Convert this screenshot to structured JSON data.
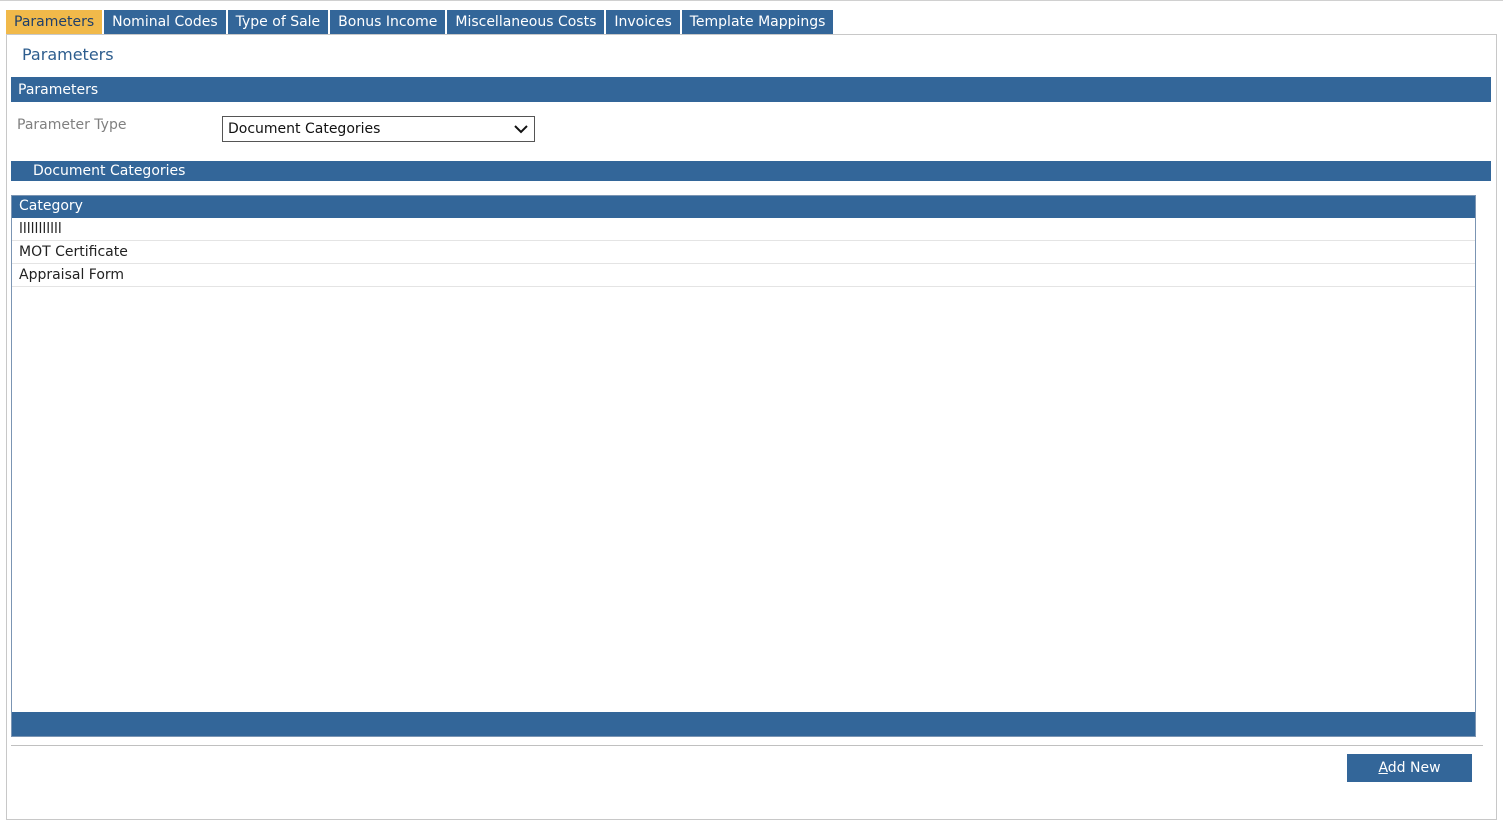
{
  "tabs": [
    {
      "label": "Parameters",
      "active": true
    },
    {
      "label": "Nominal Codes",
      "active": false
    },
    {
      "label": "Type of Sale",
      "active": false
    },
    {
      "label": "Bonus Income",
      "active": false
    },
    {
      "label": "Miscellaneous Costs",
      "active": false
    },
    {
      "label": "Invoices",
      "active": false
    },
    {
      "label": "Template Mappings",
      "active": false
    }
  ],
  "page": {
    "title": "Parameters"
  },
  "parameters_section": {
    "header": "Parameters",
    "parameter_type_label": "Parameter Type",
    "parameter_type_value": "Document Categories",
    "dropdown_icon": "chevron-down-icon"
  },
  "categories_section": {
    "header": "Document Categories",
    "column_header": "Category",
    "rows": [
      {
        "category": "lllllllllll"
      },
      {
        "category": "MOT Certificate"
      },
      {
        "category": "Appraisal Form"
      }
    ]
  },
  "actions": {
    "add_new_accel": "A",
    "add_new_rest": "dd New"
  },
  "colors": {
    "brand": "#336699",
    "active_tab": "#f1b94a",
    "title": "#2d5d8e"
  }
}
